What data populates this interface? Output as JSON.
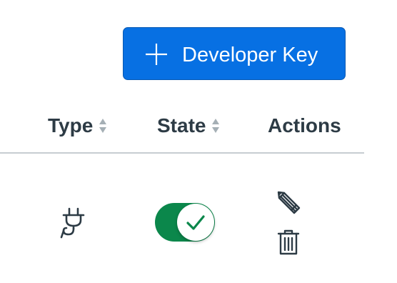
{
  "toolbar": {
    "add_button_label": "Developer Key",
    "add_button_color": "#0770e3"
  },
  "table": {
    "columns": [
      {
        "label": "Type",
        "sortable": true
      },
      {
        "label": "State",
        "sortable": true
      },
      {
        "label": "Actions",
        "sortable": false
      }
    ],
    "rows": [
      {
        "type_icon": "plug-icon",
        "state": "on",
        "state_color": "#0b874b",
        "actions": [
          "pencil-icon",
          "trash-icon"
        ]
      }
    ]
  }
}
